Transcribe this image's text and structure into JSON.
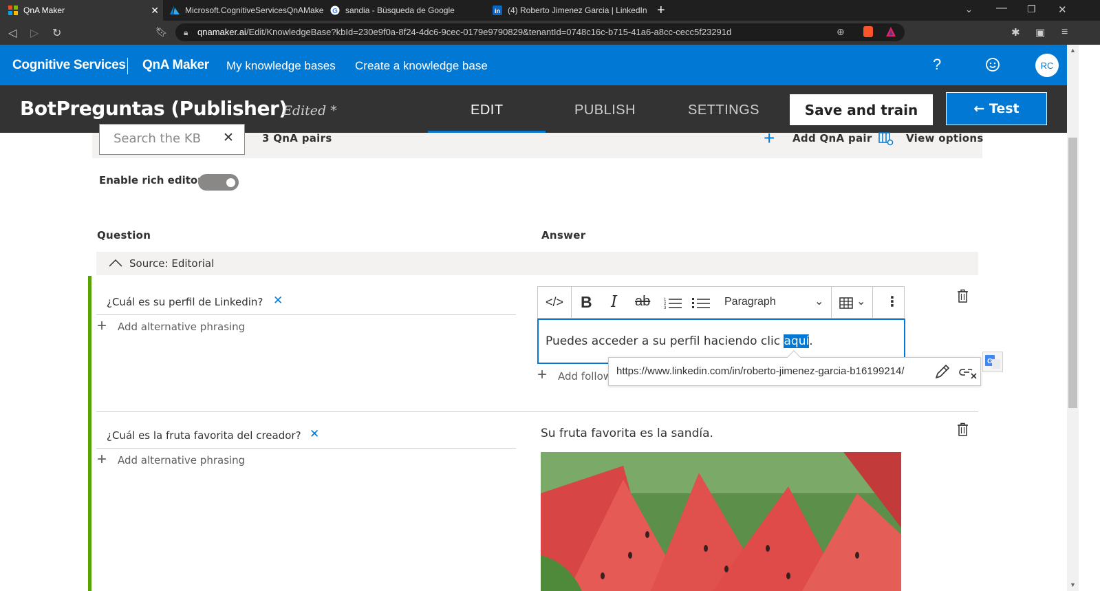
{
  "browser": {
    "tabs": [
      {
        "title": "QnA Maker",
        "active": true
      },
      {
        "title": "Microsoft.CognitiveServicesQnAMaker",
        "active": false
      },
      {
        "title": "sandia - Búsqueda de Google",
        "active": false
      },
      {
        "title": "(4) Roberto Jimenez Garcia | LinkedIn",
        "active": false
      }
    ],
    "url_host": "qnamaker.ai",
    "url_path": "/Edit/KnowledgeBase?kbId=230e9f0a-8f24-4dc6-9cec-0179e9790829&tenantId=0748c16c-b715-41a6-a8cc-cecc5f23291d"
  },
  "topnav": {
    "brand": "Cognitive Services",
    "product": "QnA Maker",
    "links": [
      "My knowledge bases",
      "Create a knowledge base"
    ],
    "help": "?",
    "avatar": "RC"
  },
  "header": {
    "title": "BotPreguntas (Publisher)",
    "status": "Edited *",
    "tabs": [
      "EDIT",
      "PUBLISH",
      "SETTINGS"
    ],
    "save_label": "Save and train",
    "test_label": "← Test"
  },
  "toolbar": {
    "search_placeholder": "Search the KB",
    "pair_count": "3 QnA pairs",
    "add_pair": "Add QnA pair",
    "view_options": "View options"
  },
  "rich_editor_label": "Enable rich editor",
  "columns": {
    "question": "Question",
    "answer": "Answer"
  },
  "source_label": "Source: Editorial",
  "qna": [
    {
      "question": "¿Cuál es su perfil de Linkedin?",
      "alt_phrasing": "Add alternative phrasing",
      "answer_prefix": "Puedes acceder a su perfil haciendo clic ",
      "answer_link": "aquí",
      "answer_suffix": ".",
      "link_url": "https://www.linkedin.com/in/roberto-jimenez-garcia-b16199214/",
      "add_follow": "Add follow"
    },
    {
      "question": "¿Cuál es la fruta favorita del creador?",
      "alt_phrasing": "Add alternative phrasing",
      "answer": "Su fruta favorita es la sandía."
    }
  ],
  "editor": {
    "format": "Paragraph"
  },
  "colors": {
    "brand_blue": "#0078d4",
    "header_dark": "#333333",
    "accent_green": "#57a300"
  }
}
